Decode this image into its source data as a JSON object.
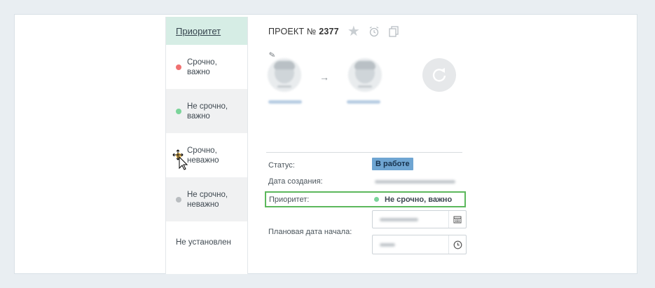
{
  "priority_column": {
    "header": "Приоритет",
    "items": [
      {
        "label_line1": "Срочно,",
        "label_line2": "важно",
        "color": "#f07171"
      },
      {
        "label_line1": "Не срочно,",
        "label_line2": "важно",
        "color": "#7bd49a"
      },
      {
        "label_line1": "Срочно,",
        "label_line2": "неважно",
        "color": "#f2c464"
      },
      {
        "label_line1": "Не срочно,",
        "label_line2": "неважно",
        "color": "#b9bdc0"
      }
    ],
    "none_label": "Не установлен"
  },
  "project": {
    "title_prefix": "ПРОЕКТ №",
    "number": "2377",
    "icons": [
      "star-icon",
      "alarm-clock-icon",
      "copy-icon"
    ]
  },
  "assignment": {
    "arrow": "→",
    "edit_icon": "pencil-icon",
    "refresh_icon": "refresh-icon"
  },
  "details": {
    "status_label": "Статус:",
    "status_value": "В работе",
    "created_label": "Дата создания:",
    "priority_label": "Приоритет:",
    "priority_value": "Не срочно, важно",
    "priority_color": "#7bd49a",
    "planned_start_label": "Плановая дата начала:"
  },
  "colors": {
    "header_bg": "#d6ede5",
    "highlight_border": "#5cb85c",
    "status_badge": "#6fa5d2"
  }
}
